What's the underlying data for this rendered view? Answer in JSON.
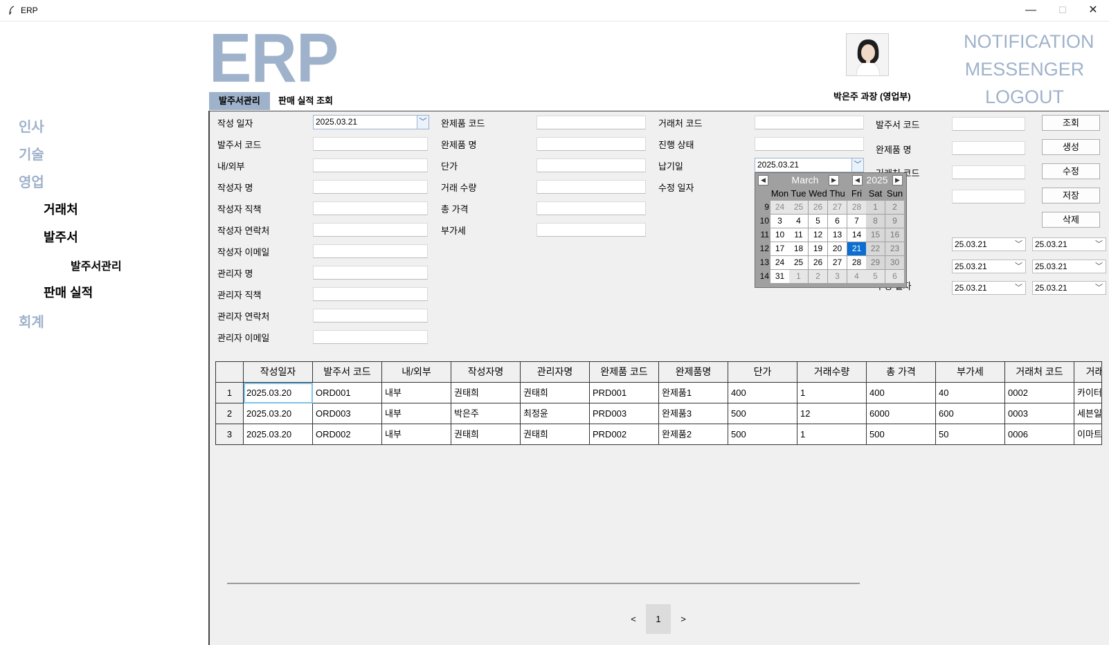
{
  "window": {
    "title": "ERP",
    "minimize": "—",
    "maximize": "☐",
    "close": "✕"
  },
  "logo": "ERP",
  "user": {
    "name": "박은주 과장 (영업부)"
  },
  "top_links": [
    "NOTIFICATION",
    "MESSENGER",
    "LOGOUT"
  ],
  "tabs": [
    "발주서관리",
    "판매 실적 조회"
  ],
  "sidebar": {
    "items": [
      {
        "label": "인사",
        "level": 1
      },
      {
        "label": "기술",
        "level": 1
      },
      {
        "label": "영업",
        "level": 1
      },
      {
        "label": "거래처",
        "level": 2
      },
      {
        "label": "발주서",
        "level": 2
      },
      {
        "label": "발주서관리",
        "level": 3
      },
      {
        "label": "판매 실적",
        "level": 2
      },
      {
        "label": "회계",
        "level": 1
      }
    ]
  },
  "form": {
    "col1": [
      {
        "label": "작성 일자",
        "value": "2025.03.21"
      },
      {
        "label": "발주서 코드",
        "value": ""
      },
      {
        "label": "내/외부",
        "value": ""
      },
      {
        "label": "작성자 명",
        "value": ""
      },
      {
        "label": "작성자 직책",
        "value": ""
      },
      {
        "label": "작성자 연락처",
        "value": ""
      },
      {
        "label": "작성자 이메일",
        "value": ""
      },
      {
        "label": "관리자 명",
        "value": ""
      },
      {
        "label": "관리자 직책",
        "value": ""
      },
      {
        "label": "관리자 연락처",
        "value": ""
      },
      {
        "label": "관리자 이메일",
        "value": ""
      }
    ],
    "col2": [
      {
        "label": "완제품 코드",
        "value": ""
      },
      {
        "label": "완제품 명",
        "value": ""
      },
      {
        "label": "단가",
        "value": ""
      },
      {
        "label": "거래 수량",
        "value": ""
      },
      {
        "label": "총 가격",
        "value": ""
      },
      {
        "label": "부가세",
        "value": ""
      }
    ],
    "col3": [
      {
        "label": "거래처 코드",
        "value": ""
      },
      {
        "label": "진행 상태",
        "value": ""
      },
      {
        "label": "납기일",
        "value": "2025.03.21"
      },
      {
        "label": "수정 일자",
        "value": ""
      }
    ],
    "search": [
      {
        "label": "발주서 코드",
        "value": ""
      },
      {
        "label": "완제품 명",
        "value": ""
      },
      {
        "label": "거래처 코드",
        "value": ""
      },
      {
        "label": "",
        "value": ""
      }
    ],
    "date_ranges": [
      {
        "label": "",
        "from": "25.03.21",
        "to": "25.03.21"
      },
      {
        "label": "",
        "from": "25.03.21",
        "to": "25.03.21"
      },
      {
        "label": "수정 일자",
        "from": "25.03.21",
        "to": "25.03.21"
      }
    ],
    "buttons": [
      "조회",
      "생성",
      "수정",
      "저장",
      "삭제"
    ]
  },
  "calendar": {
    "month": "March",
    "year": "2025",
    "dow": [
      "Mon",
      "Tue",
      "Wed",
      "Thu",
      "Fri",
      "Sat",
      "Sun"
    ],
    "weeks": [
      {
        "wk": "9",
        "days": [
          "24",
          "25",
          "26",
          "27",
          "28",
          "1",
          "2"
        ]
      },
      {
        "wk": "10",
        "days": [
          "3",
          "4",
          "5",
          "6",
          "7",
          "8",
          "9"
        ]
      },
      {
        "wk": "11",
        "days": [
          "10",
          "11",
          "12",
          "13",
          "14",
          "15",
          "16"
        ]
      },
      {
        "wk": "12",
        "days": [
          "17",
          "18",
          "19",
          "20",
          "21",
          "22",
          "23"
        ]
      },
      {
        "wk": "13",
        "days": [
          "24",
          "25",
          "26",
          "27",
          "28",
          "29",
          "30"
        ]
      },
      {
        "wk": "14",
        "days": [
          "31",
          "1",
          "2",
          "3",
          "4",
          "5",
          "6"
        ]
      }
    ],
    "selected": "21"
  },
  "table": {
    "columns": [
      "작성일자",
      "발주서 코드",
      "내/외부",
      "작성자명",
      "관리자명",
      "완제품 코드",
      "완제품명",
      "단가",
      "거래수량",
      "총 가격",
      "부가세",
      "거래처 코드",
      "거래"
    ],
    "rows": [
      {
        "num": "1",
        "cells": [
          "2025.03.20",
          "ORD001",
          "내부",
          "권태희",
          "권태희",
          "PRD001",
          "완제품1",
          "400",
          "1",
          "400",
          "40",
          "0002",
          "카이터"
        ]
      },
      {
        "num": "2",
        "cells": [
          "2025.03.20",
          "ORD003",
          "내부",
          "박은주",
          "최정윤",
          "PRD003",
          "완제품3",
          "500",
          "12",
          "6000",
          "600",
          "0003",
          "세븐일"
        ]
      },
      {
        "num": "3",
        "cells": [
          "2025.03.20",
          "ORD002",
          "내부",
          "권태희",
          "권태희",
          "PRD002",
          "완제품2",
          "500",
          "1",
          "500",
          "50",
          "0006",
          "이마트"
        ]
      }
    ]
  },
  "pager": {
    "prev": "<",
    "page": "1",
    "next": ">"
  }
}
